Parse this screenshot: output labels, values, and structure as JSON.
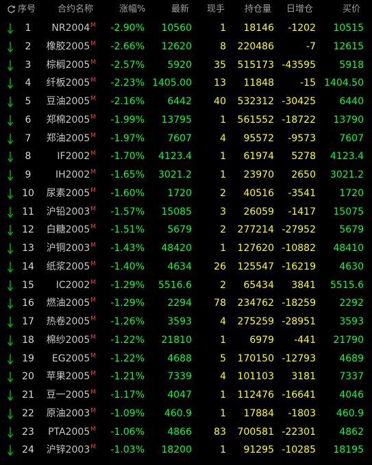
{
  "colors": {
    "background": "#000000",
    "header_text": "#a0a0a0",
    "down": "#00ff33",
    "volume": "#ffff00",
    "main_marker": "#ff3a3a",
    "arrow": "#00c000"
  },
  "header": {
    "refresh_icon": "refresh-icon",
    "seq": "序号",
    "name": "合约名称",
    "change_pct": "涨幅%",
    "last": "最新",
    "volume": "现手",
    "open_interest": "持仓量",
    "oi_change": "日增仓",
    "bid": "买价"
  },
  "main_marker": "M",
  "rows": [
    {
      "idx": "1",
      "name": "NR2004",
      "chg": "-2.90%",
      "last": "10560",
      "vol": "1",
      "oi": "18146",
      "oichg": "-1202",
      "bid": "10515"
    },
    {
      "idx": "2",
      "name": "橡胶2005",
      "chg": "-2.66%",
      "last": "12620",
      "vol": "8",
      "oi": "220486",
      "oichg": "-7",
      "bid": "12615"
    },
    {
      "idx": "3",
      "name": "棕榈2005",
      "chg": "-2.57%",
      "last": "5920",
      "vol": "35",
      "oi": "515173",
      "oichg": "-43595",
      "bid": "5918"
    },
    {
      "idx": "4",
      "name": "纤板2005",
      "chg": "-2.23%",
      "last": "1405.00",
      "vol": "13",
      "oi": "11848",
      "oichg": "-15",
      "bid": "1404.50"
    },
    {
      "idx": "5",
      "name": "豆油2005",
      "chg": "-2.16%",
      "last": "6442",
      "vol": "40",
      "oi": "532312",
      "oichg": "-30425",
      "bid": "6440"
    },
    {
      "idx": "6",
      "name": "郑棉2005",
      "chg": "-1.99%",
      "last": "13795",
      "vol": "1",
      "oi": "561552",
      "oichg": "-18722",
      "bid": "13790"
    },
    {
      "idx": "7",
      "name": "郑油2005",
      "chg": "-1.97%",
      "last": "7607",
      "vol": "4",
      "oi": "95572",
      "oichg": "-9573",
      "bid": "7607"
    },
    {
      "idx": "8",
      "name": "IF2002",
      "chg": "-1.70%",
      "last": "4123.4",
      "vol": "1",
      "oi": "61974",
      "oichg": "5278",
      "bid": "4123.4"
    },
    {
      "idx": "9",
      "name": "IH2002",
      "chg": "-1.65%",
      "last": "3021.2",
      "vol": "1",
      "oi": "23970",
      "oichg": "2650",
      "bid": "3021.2"
    },
    {
      "idx": "10",
      "name": "尿素2005",
      "chg": "-1.60%",
      "last": "1720",
      "vol": "2",
      "oi": "40516",
      "oichg": "-3541",
      "bid": "1720"
    },
    {
      "idx": "11",
      "name": "沪铅2003",
      "chg": "-1.57%",
      "last": "15085",
      "vol": "3",
      "oi": "26059",
      "oichg": "-1417",
      "bid": "15075"
    },
    {
      "idx": "12",
      "name": "白糖2005",
      "chg": "-1.51%",
      "last": "5679",
      "vol": "2",
      "oi": "277214",
      "oichg": "-27952",
      "bid": "5679"
    },
    {
      "idx": "13",
      "name": "沪铜2003",
      "chg": "-1.43%",
      "last": "48420",
      "vol": "1",
      "oi": "127620",
      "oichg": "-10882",
      "bid": "48410"
    },
    {
      "idx": "14",
      "name": "纸浆2005",
      "chg": "-1.40%",
      "last": "4634",
      "vol": "26",
      "oi": "125547",
      "oichg": "-16219",
      "bid": "4630"
    },
    {
      "idx": "15",
      "name": "IC2002",
      "chg": "-1.29%",
      "last": "5516.6",
      "vol": "2",
      "oi": "65434",
      "oichg": "3841",
      "bid": "5515.6"
    },
    {
      "idx": "16",
      "name": "燃油2005",
      "chg": "-1.29%",
      "last": "2294",
      "vol": "78",
      "oi": "234762",
      "oichg": "-18259",
      "bid": "2292"
    },
    {
      "idx": "17",
      "name": "热卷2005",
      "chg": "-1.26%",
      "last": "3593",
      "vol": "4",
      "oi": "275259",
      "oichg": "-28951",
      "bid": "3593"
    },
    {
      "idx": "18",
      "name": "棉纱2005",
      "chg": "-1.22%",
      "last": "21810",
      "vol": "1",
      "oi": "6979",
      "oichg": "-441",
      "bid": "21790"
    },
    {
      "idx": "19",
      "name": "EG2005",
      "chg": "-1.22%",
      "last": "4688",
      "vol": "5",
      "oi": "170150",
      "oichg": "-12793",
      "bid": "4689"
    },
    {
      "idx": "20",
      "name": "苹果2005",
      "chg": "-1.21%",
      "last": "7339",
      "vol": "4",
      "oi": "101103",
      "oichg": "3181",
      "bid": "7337"
    },
    {
      "idx": "21",
      "name": "豆一2005",
      "chg": "-1.17%",
      "last": "4047",
      "vol": "1",
      "oi": "112476",
      "oichg": "-16641",
      "bid": "4046"
    },
    {
      "idx": "22",
      "name": "原油2003",
      "chg": "-1.09%",
      "last": "460.9",
      "vol": "1",
      "oi": "17884",
      "oichg": "-1803",
      "bid": "460.9"
    },
    {
      "idx": "23",
      "name": "PTA2005",
      "chg": "-1.06%",
      "last": "4866",
      "vol": "83",
      "oi": "700581",
      "oichg": "-22301",
      "bid": "4862"
    },
    {
      "idx": "24",
      "name": "沪锌2003",
      "chg": "-1.03%",
      "last": "18200",
      "vol": "1",
      "oi": "91295",
      "oichg": "-10285",
      "bid": "18195"
    }
  ]
}
